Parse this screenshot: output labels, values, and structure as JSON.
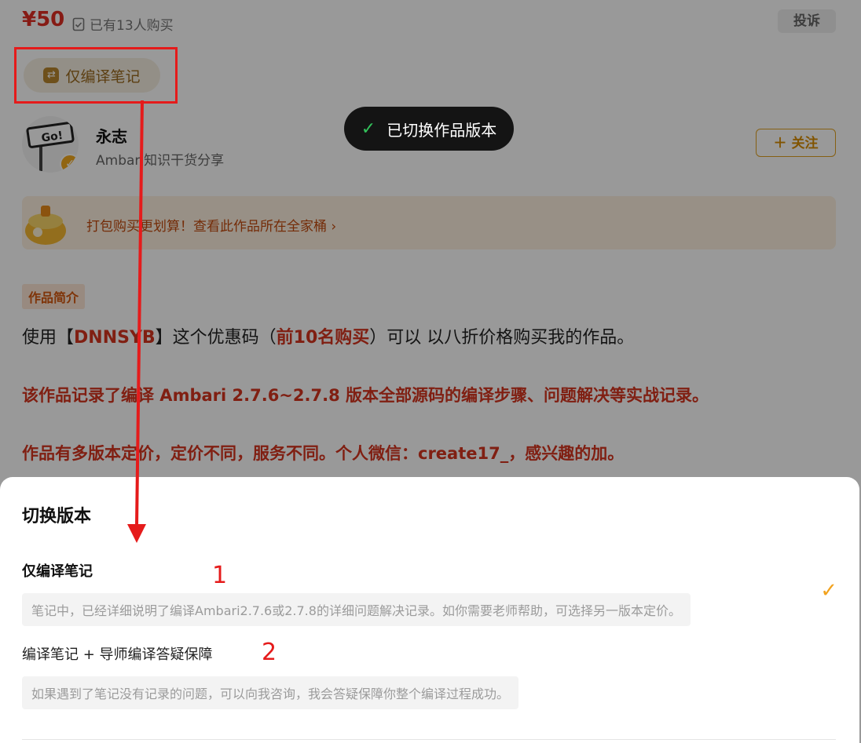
{
  "product": {
    "price": "¥50",
    "buyers_text": "已有13人购买",
    "complain_label": "投诉",
    "current_version_chip": "仅编译笔记"
  },
  "author": {
    "name": "永志",
    "desc": "Ambari知识干货分享",
    "follow_label": "关注",
    "avatar_text": "Go!"
  },
  "bundle": {
    "text": "打包购买更划算！查看此作品所在全家桶"
  },
  "intro": {
    "tag": "作品简介",
    "line1_a": "使用【",
    "line1_code": "DNNSYB",
    "line1_b": "】这个优惠码（",
    "line1_limit": "前10名购买",
    "line1_c": "）可以 以八折价格购买我的作品。",
    "line2": "该作品记录了编译 Ambari 2.7.6~2.7.8 版本全部源码的编译步骤、问题解决等实战记录。",
    "line3": "作品有多版本定价，定价不同，服务不同。个人微信：create17_，感兴趣的加。"
  },
  "toast": {
    "text": "已切换作品版本"
  },
  "sheet": {
    "title": "切换版本",
    "options": [
      {
        "name": "仅编译笔记",
        "desc": "笔记中，已经详细说明了编译Ambari2.7.6或2.7.8的详细问题解决记录。如你需要老师帮助，可选择另一版本定价。",
        "selected": true
      },
      {
        "name": "编译笔记 + 导师编译答疑保障",
        "desc": "如果遇到了笔记没有记录的问题，可以向我咨询，我会答疑保障你整个编译过程成功。",
        "selected": false
      }
    ]
  },
  "annotations": {
    "num1": "1",
    "num2": "2",
    "color": "#e51b1b"
  },
  "icons": {
    "buyers": "document-check-icon",
    "chip": "swap-icon",
    "follow": "plus-icon",
    "toast": "check-icon",
    "selected": "check-icon"
  }
}
